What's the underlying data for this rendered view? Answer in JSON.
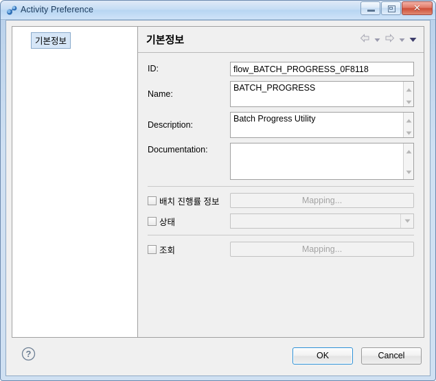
{
  "window": {
    "title": "Activity Preference",
    "app_icon": "nodes-icon",
    "controls": {
      "minimize": "minimize-icon",
      "maximize": "restore-icon",
      "close": "✕"
    },
    "frame_color": "#b8d0ea",
    "titlebar_color": "#c4dcf4"
  },
  "sidebar": {
    "items": [
      {
        "label": "기본정보",
        "selected": true
      }
    ]
  },
  "pane": {
    "title": "기본정보",
    "nav": [
      {
        "name": "back-arrow-icon"
      },
      {
        "name": "back-dropdown-icon"
      },
      {
        "name": "forward-arrow-icon"
      },
      {
        "name": "forward-dropdown-icon"
      },
      {
        "name": "menu-chevron-icon"
      }
    ]
  },
  "form": {
    "id": {
      "label": "ID:",
      "value": "flow_BATCH_PROGRESS_0F8118",
      "placeholder": ""
    },
    "name": {
      "label": "Name:",
      "value": "BATCH_PROGRESS",
      "placeholder": ""
    },
    "description": {
      "label": "Description:",
      "value": "Batch Progress Utility",
      "placeholder": ""
    },
    "documentation": {
      "label": "Documentation:",
      "value": "",
      "placeholder": ""
    }
  },
  "options": [
    {
      "label": "배치 진행률 정보",
      "checked": false,
      "control": "button",
      "control_label": "Mapping...",
      "disabled": true
    },
    {
      "label": "상태",
      "checked": false,
      "control": "combo",
      "control_label": "",
      "disabled": true
    },
    {
      "label": "조회",
      "checked": false,
      "control": "button",
      "control_label": "Mapping...",
      "disabled": true
    }
  ],
  "footer": {
    "help_icon": "help-question-icon",
    "ok_label": "OK",
    "cancel_label": "Cancel",
    "focus_color": "#2a8fd6"
  }
}
